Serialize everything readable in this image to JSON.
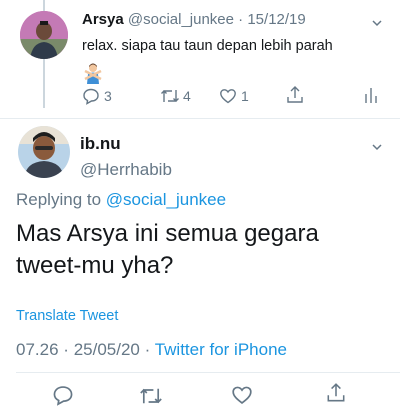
{
  "parent_tweet": {
    "display_name": "Arsya",
    "handle": "@social_junkee",
    "separator": "·",
    "date": "15/12/19",
    "text": "relax. siapa tau taun depan lebih parah",
    "emoji": "person-gesturing-no-emoji",
    "reply_count": "3",
    "retweet_count": "4",
    "like_count": "1"
  },
  "main_tweet": {
    "display_name": "ib.nu",
    "handle": "@Herrhabib",
    "replying_prefix": "Replying to",
    "replying_handle": "@social_junkee",
    "text": "Mas Arsya ini semua gegara tweet-mu yha?",
    "translate_label": "Translate Tweet",
    "time": "07.26",
    "meta_sep1": "·",
    "date": "25/05/20",
    "meta_sep2": "·",
    "source": "Twitter for iPhone"
  },
  "colors": {
    "link": "#1b95e0",
    "secondary_text": "#657786",
    "divider": "#e6ecf0"
  }
}
